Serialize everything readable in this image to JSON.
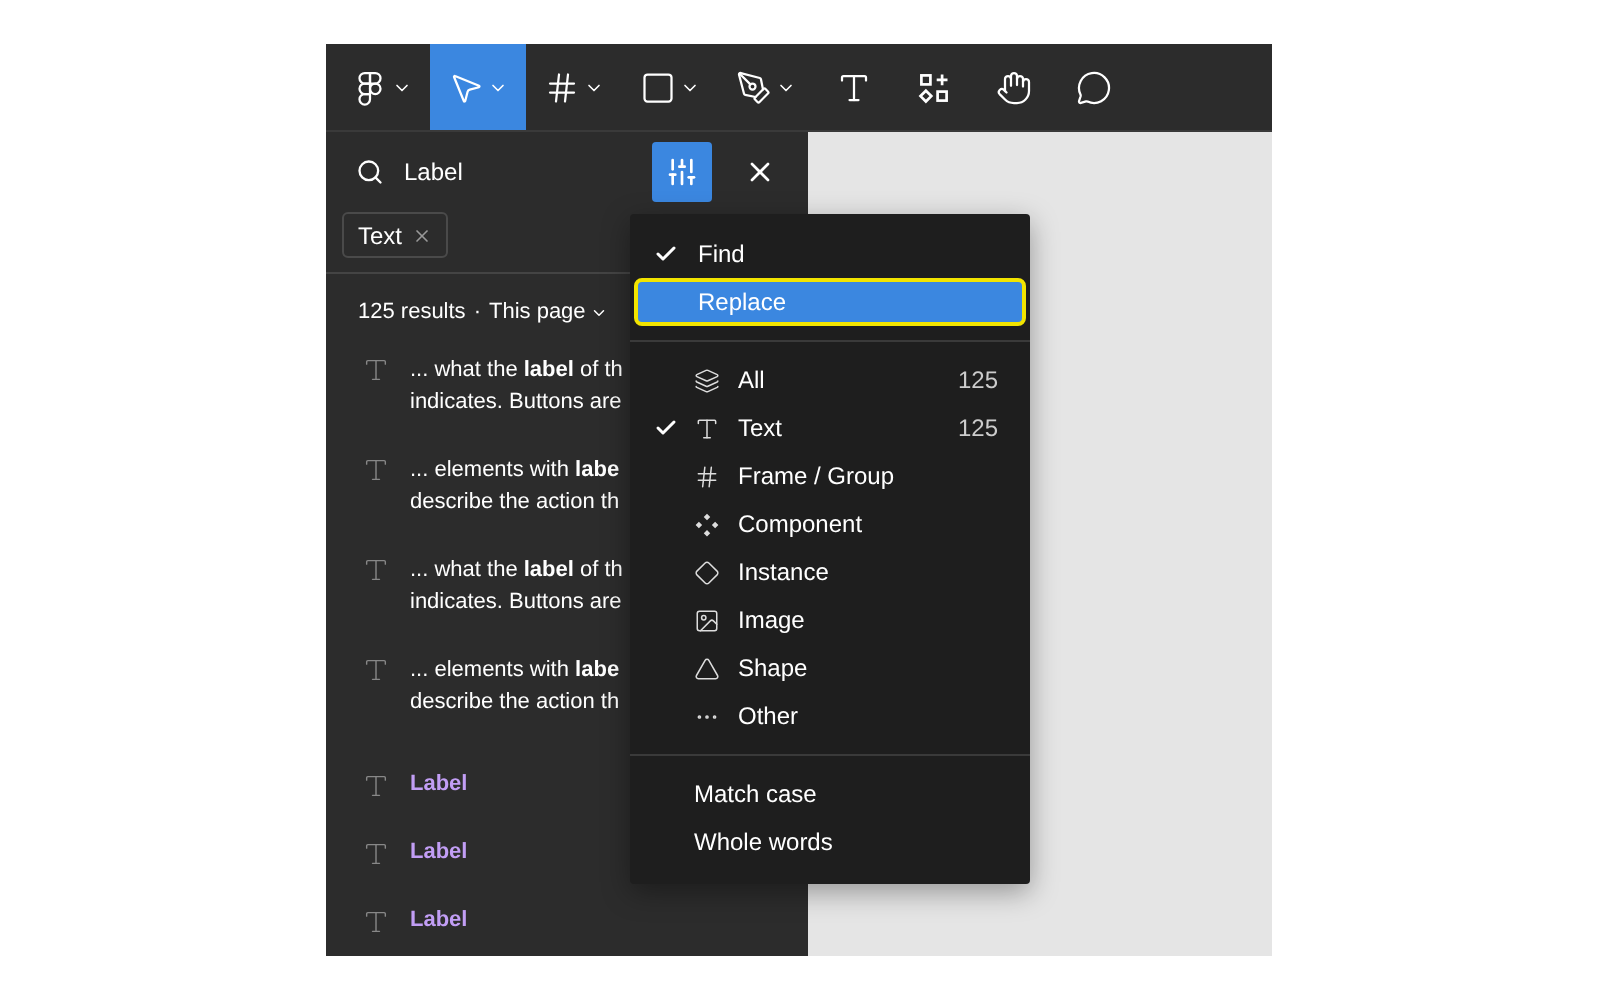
{
  "toolbar": [
    {
      "kind": "logo",
      "caret": true,
      "selected": false
    },
    {
      "kind": "move",
      "caret": true,
      "selected": true
    },
    {
      "kind": "frame",
      "caret": true,
      "selected": false
    },
    {
      "kind": "shape",
      "caret": true,
      "selected": false
    },
    {
      "kind": "pen",
      "caret": true,
      "selected": false
    },
    {
      "kind": "text",
      "caret": false,
      "selected": false
    },
    {
      "kind": "resources",
      "caret": false,
      "selected": false
    },
    {
      "kind": "hand",
      "caret": false,
      "selected": false
    },
    {
      "kind": "comment",
      "caret": false,
      "selected": false
    }
  ],
  "search": {
    "value": "Label",
    "filter_active": true
  },
  "chips": [
    {
      "label": "Text"
    }
  ],
  "results_header": {
    "count": "125 results",
    "separator": "·",
    "scope": "This page"
  },
  "results": [
    {
      "kind": "snippet",
      "lines": [
        "... what the **label** of th",
        "indicates. Buttons are"
      ]
    },
    {
      "kind": "snippet",
      "lines": [
        "... elements with **labe**",
        "describe the action th"
      ]
    },
    {
      "kind": "snippet",
      "lines": [
        "... what the **label** of th",
        "indicates. Buttons are"
      ]
    },
    {
      "kind": "snippet",
      "lines": [
        "... elements with **labe**",
        "describe the action th"
      ]
    },
    {
      "kind": "name",
      "lines": [
        "Label"
      ]
    },
    {
      "kind": "name",
      "lines": [
        "Label"
      ]
    },
    {
      "kind": "name",
      "lines": [
        "Label"
      ]
    }
  ],
  "menu": {
    "modes": [
      {
        "label": "Find",
        "checked": true,
        "selected": false
      },
      {
        "label": "Replace",
        "checked": false,
        "selected": true
      }
    ],
    "types": [
      {
        "kind": "all",
        "label": "All",
        "count": "125",
        "checked": false
      },
      {
        "kind": "text",
        "label": "Text",
        "count": "125",
        "checked": true
      },
      {
        "kind": "frame",
        "label": "Frame / Group",
        "checked": false
      },
      {
        "kind": "component",
        "label": "Component",
        "checked": false
      },
      {
        "kind": "instance",
        "label": "Instance",
        "checked": false
      },
      {
        "kind": "image",
        "label": "Image",
        "checked": false
      },
      {
        "kind": "shape",
        "label": "Shape",
        "checked": false
      },
      {
        "kind": "other",
        "label": "Other",
        "checked": false
      }
    ],
    "options": [
      {
        "label": "Match case",
        "checked": false
      },
      {
        "label": "Whole words",
        "checked": false
      }
    ]
  }
}
